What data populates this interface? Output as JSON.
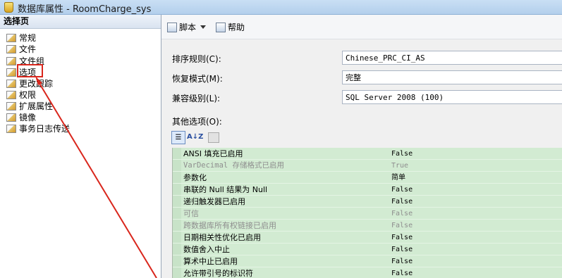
{
  "window": {
    "title": "数据库属性 - RoomCharge_sys",
    "app_icon": "database-icon"
  },
  "left_pane": {
    "header": "选择页",
    "items": [
      {
        "label": "常规",
        "icon": "page-icon"
      },
      {
        "label": "文件",
        "icon": "page-icon"
      },
      {
        "label": "文件组",
        "icon": "page-icon"
      },
      {
        "label": "选项",
        "icon": "page-icon",
        "selected": true
      },
      {
        "label": "更改跟踪",
        "icon": "page-icon"
      },
      {
        "label": "权限",
        "icon": "page-icon"
      },
      {
        "label": "扩展属性",
        "icon": "page-icon"
      },
      {
        "label": "镜像",
        "icon": "page-icon"
      },
      {
        "label": "事务日志传送",
        "icon": "page-icon"
      }
    ]
  },
  "toolbar": {
    "script_label": "脚本",
    "help_label": "帮助",
    "script_icon": "script-icon",
    "help_icon": "help-icon"
  },
  "properties": {
    "collation_label": "排序规则(C):",
    "collation_value": "Chinese_PRC_CI_AS",
    "recovery_label": "恢复模式(M):",
    "recovery_value": "完整",
    "compat_label": "兼容级别(L):",
    "compat_value": "SQL Server 2008 (100)",
    "other_label": "其他选项(O):"
  },
  "sort_buttons": {
    "categorized_icon": "categorized-icon",
    "az_label": "A↓Z",
    "pages_icon": "property-pages-icon"
  },
  "options": [
    {
      "name": "ANSI 填充已启用",
      "value": "False",
      "dim": false
    },
    {
      "name": "VarDecimal 存储格式已启用",
      "value": "True",
      "dim": true
    },
    {
      "name": "参数化",
      "value": "简单",
      "dim": false
    },
    {
      "name": "串联的 Null 结果为 Null",
      "value": "False",
      "dim": false
    },
    {
      "name": "递归触发器已启用",
      "value": "False",
      "dim": false
    },
    {
      "name": "可信",
      "value": "False",
      "dim": true
    },
    {
      "name": "跨数据库所有权链接已启用",
      "value": "False",
      "dim": true
    },
    {
      "name": "日期相关性优化已启用",
      "value": "False",
      "dim": false
    },
    {
      "name": "数值舍入中止",
      "value": "False",
      "dim": false
    },
    {
      "name": "算术中止已启用",
      "value": "False",
      "dim": false
    },
    {
      "name": "允许带引号的标识符",
      "value": "False",
      "dim": false
    }
  ],
  "colors": {
    "annotation": "#d9261c",
    "grid_bg": "#d2ebd2"
  }
}
